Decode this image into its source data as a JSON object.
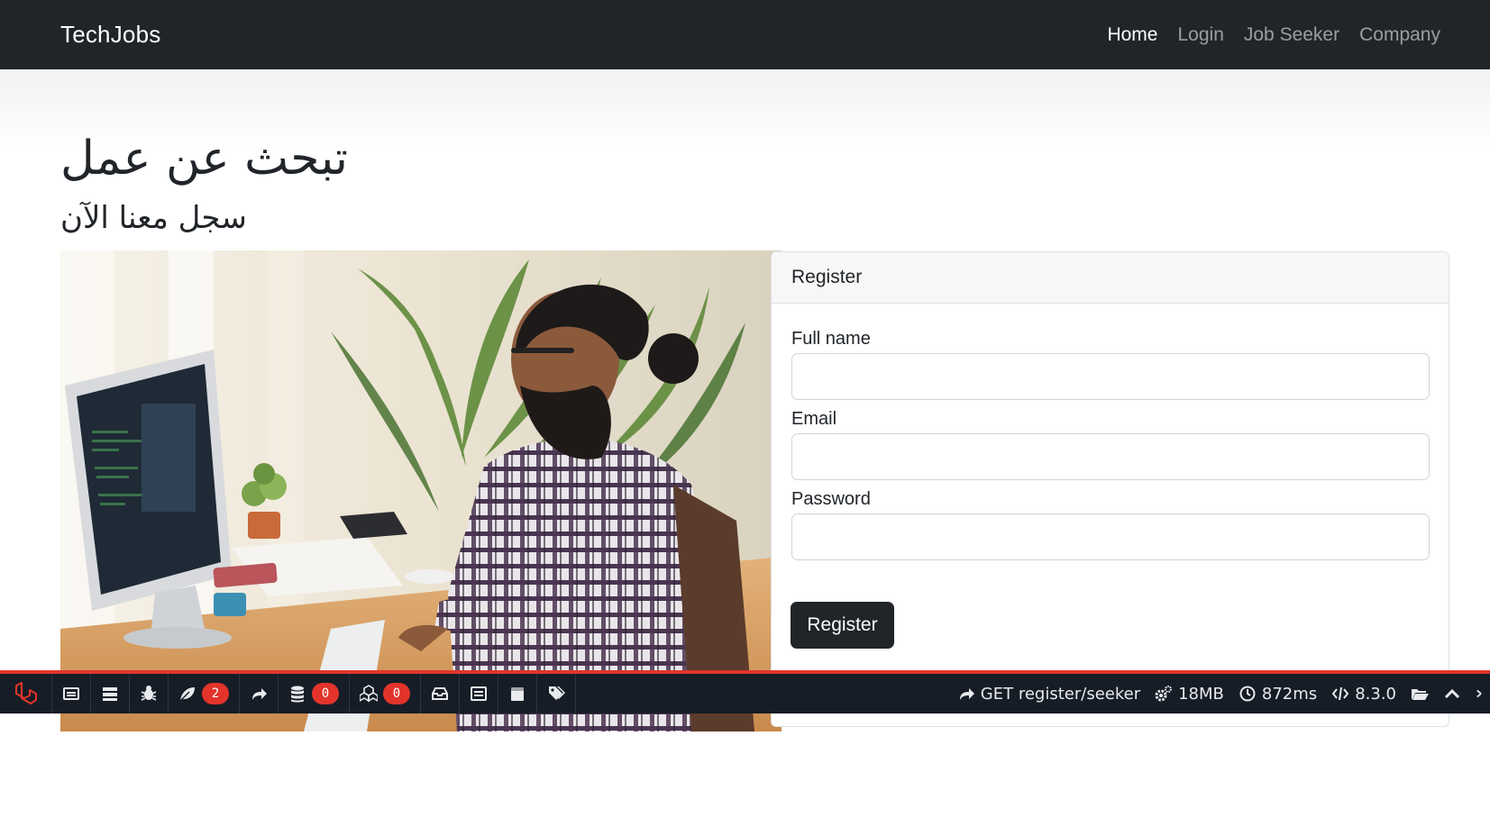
{
  "navbar": {
    "brand": "TechJobs",
    "links": [
      {
        "label": "Home",
        "active": true
      },
      {
        "label": "Login",
        "active": false
      },
      {
        "label": "Job Seeker",
        "active": false
      },
      {
        "label": "Company",
        "active": false
      }
    ]
  },
  "hero": {
    "title": "تبحث عن عمل",
    "subtitle": "سجل معنا الآن"
  },
  "register_card": {
    "header": "Register",
    "fields": [
      {
        "label": "Full name",
        "value": "",
        "placeholder": ""
      },
      {
        "label": "Email",
        "value": "",
        "placeholder": ""
      },
      {
        "label": "Password",
        "value": "",
        "placeholder": ""
      }
    ],
    "submit_label": "Register"
  },
  "debugbar": {
    "tabs": [
      {
        "icon": "messages-icon"
      },
      {
        "icon": "timeline-icon"
      },
      {
        "icon": "exceptions-icon"
      },
      {
        "icon": "views-icon",
        "badge": "2"
      },
      {
        "icon": "route-icon"
      },
      {
        "icon": "queries-icon",
        "badge": "0"
      },
      {
        "icon": "models-icon",
        "badge": "0"
      },
      {
        "icon": "mails-icon"
      },
      {
        "icon": "request-icon"
      },
      {
        "icon": "session-icon"
      },
      {
        "icon": "tags-icon"
      }
    ],
    "route": "GET register/seeker",
    "memory": "18MB",
    "duration": "872ms",
    "php_version": "8.3.0"
  },
  "colors": {
    "navbar_bg": "#212529",
    "debugbar_bg": "#161d27",
    "debugbar_accent": "#e2342a",
    "button_bg": "#212529"
  }
}
